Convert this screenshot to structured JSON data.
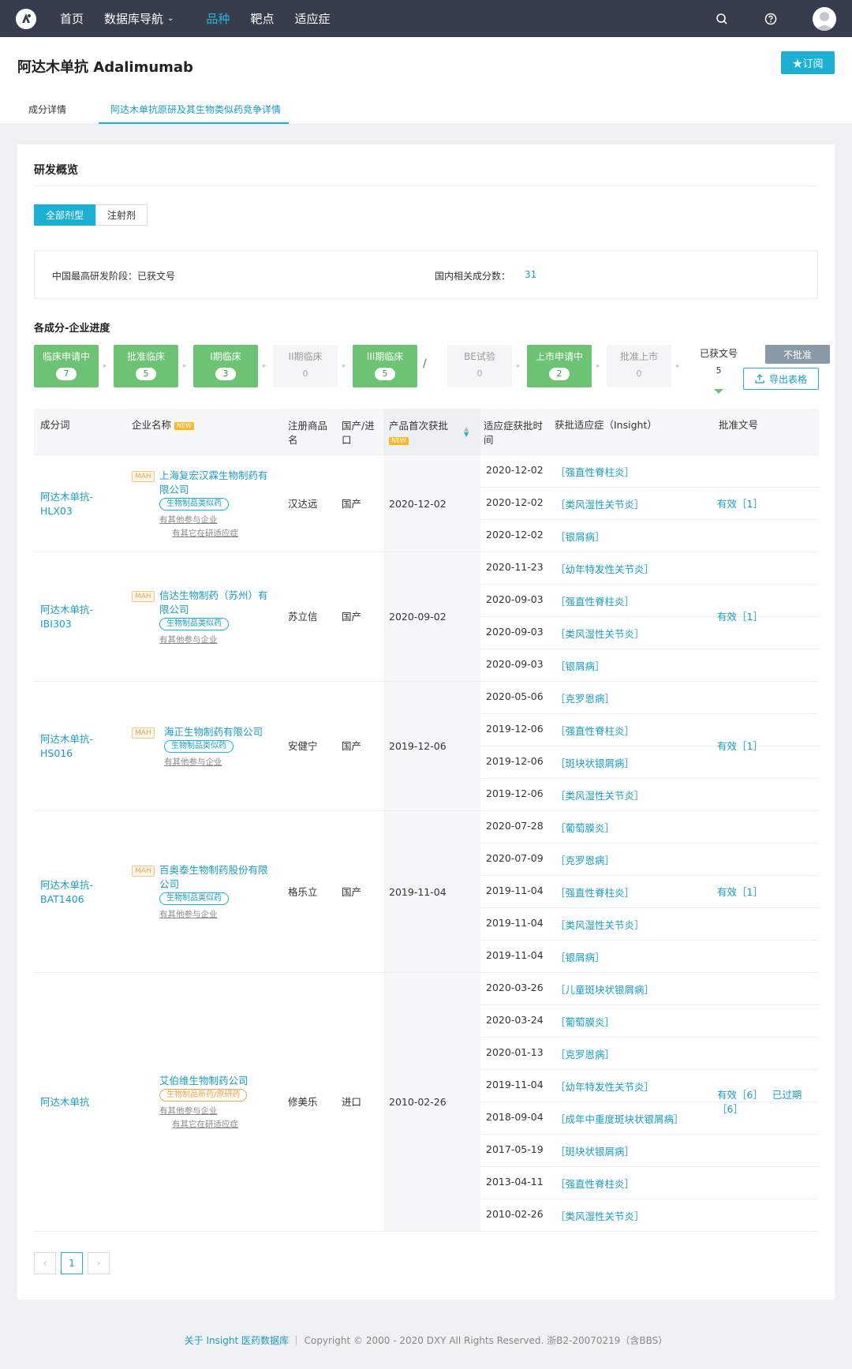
{
  "nav": {
    "items": [
      {
        "label": "首页",
        "active": false,
        "dropdown": false
      },
      {
        "label": "数据库导航",
        "active": false,
        "dropdown": true
      },
      {
        "label": "品种",
        "active": true,
        "dropdown": false
      },
      {
        "label": "靶点",
        "active": false,
        "dropdown": false
      },
      {
        "label": "适应症",
        "active": false,
        "dropdown": false
      }
    ],
    "icons": [
      "search-icon",
      "help-icon",
      "avatar"
    ]
  },
  "header": {
    "title": "阿达木单抗 Adalimumab",
    "subscribe_label": "★订阅"
  },
  "tabs": [
    {
      "label": "成分详情",
      "active": false
    },
    {
      "label": "阿达木单抗原研及其生物类似药竞争详情",
      "active": true
    }
  ],
  "overview": {
    "title": "研发概览",
    "dosage_tabs": [
      {
        "label": "全部剂型",
        "active": true
      },
      {
        "label": "注射剂",
        "active": false
      }
    ],
    "highest_stage_label": "中国最高研发阶段：已获文号",
    "related_count_label": "国内相关成分数：",
    "related_count_value": "31"
  },
  "progress": {
    "title": "各成分-企业进度",
    "stages": [
      {
        "label": "临床申请中",
        "count": "7",
        "state": "on"
      },
      {
        "label": "批准临床",
        "count": "5",
        "state": "on"
      },
      {
        "label": "I期临床",
        "count": "3",
        "state": "on"
      },
      {
        "label": "II期临床",
        "count": "0",
        "state": "off"
      },
      {
        "label": "III期临床",
        "count": "5",
        "state": "on"
      },
      {
        "label": "BE试验",
        "count": "0",
        "state": "off"
      },
      {
        "label": "上市申请中",
        "count": "2",
        "state": "on"
      },
      {
        "label": "批准上市",
        "count": "0",
        "state": "off"
      },
      {
        "label": "已获文号",
        "count": "5",
        "state": "sel"
      },
      {
        "label": "不批准",
        "count": "",
        "state": "gray"
      }
    ],
    "slash": "/",
    "export_label": "导出表格"
  },
  "table": {
    "headers": {
      "ingredient": "成分词",
      "company": "企业名称",
      "company_badge": "NEW",
      "brand_1": "注册商品",
      "brand_2": "名",
      "origin_1": "国产/进",
      "origin_2": "口",
      "first_approval": "产品首次获批",
      "first_approval_badge": "NEW",
      "ind_time_1": "适应症获批时",
      "ind_time_2": "间",
      "indication": "获批适应症（Insight）",
      "approval_no": "批准文号"
    },
    "rows": [
      {
        "ingredient_1": "阿达木单抗-",
        "ingredient_2": "HLX03",
        "mah": "MAH",
        "company_1": "上海复宏汉霖生物制药有",
        "company_2": "限公司",
        "tag": "生物制品类似药",
        "link_1": "有其他参与企业",
        "link_2": "有其它在研适应症",
        "brand": "汉达远",
        "origin": "国产",
        "first_approval": "2020-12-02",
        "approval": "有效［1］",
        "indications": [
          {
            "date": "2020-12-02",
            "name": "［强直性脊柱炎］"
          },
          {
            "date": "2020-12-02",
            "name": "［类风湿性关节炎］"
          },
          {
            "date": "2020-12-02",
            "name": "［银屑病］"
          }
        ]
      },
      {
        "ingredient_1": "阿达木单抗-",
        "ingredient_2": "IBI303",
        "mah": "MAH",
        "company_1": "信达生物制药（苏州）有",
        "company_2": "限公司",
        "tag": "生物制品类似药",
        "link_1": "有其他参与企业",
        "brand": "苏立信",
        "origin": "国产",
        "first_approval": "2020-09-02",
        "approval": "有效［1］",
        "indications": [
          {
            "date": "2020-11-23",
            "name": "［幼年特发性关节炎］"
          },
          {
            "date": "2020-09-03",
            "name": "［强直性脊柱炎］"
          },
          {
            "date": "2020-09-03",
            "name": "［类风湿性关节炎］"
          },
          {
            "date": "2020-09-03",
            "name": "［银屑病］"
          }
        ]
      },
      {
        "ingredient_1": "阿达木单抗-",
        "ingredient_2": "HS016",
        "mah": "MAH",
        "company_1": "海正生物制药有限公司",
        "tag": "生物制品类似药",
        "link_1": "有其他参与企业",
        "brand": "安健宁",
        "origin": "国产",
        "first_approval": "2019-12-06",
        "approval": "有效［1］",
        "indications": [
          {
            "date": "2020-05-06",
            "name": "［克罗恩病］"
          },
          {
            "date": "2019-12-06",
            "name": "［强直性脊柱炎］"
          },
          {
            "date": "2019-12-06",
            "name": "［斑块状银屑病］"
          },
          {
            "date": "2019-12-06",
            "name": "［类风湿性关节炎］"
          }
        ]
      },
      {
        "ingredient_1": "阿达木单抗-",
        "ingredient_2": "BAT1406",
        "mah": "MAH",
        "company_1": "百奥泰生物制药股份有限",
        "company_2": "公司",
        "tag": "生物制品类似药",
        "link_1": "有其他参与企业",
        "brand": "格乐立",
        "origin": "国产",
        "first_approval": "2019-11-04",
        "approval": "有效［1］",
        "indications": [
          {
            "date": "2020-07-28",
            "name": "［葡萄膜炎］"
          },
          {
            "date": "2020-07-09",
            "name": "［克罗恩病］"
          },
          {
            "date": "2019-11-04",
            "name": "［强直性脊柱炎］"
          },
          {
            "date": "2019-11-04",
            "name": "［类风湿性关节炎］"
          },
          {
            "date": "2019-11-04",
            "name": "［银屑病］"
          }
        ]
      },
      {
        "ingredient_1": "阿达木单抗",
        "company_1": "艾伯维生物制药公司",
        "tag": "生物制品新药/原研药",
        "link_1": "有其他参与企业",
        "link_2": "有其它在研适应症",
        "brand": "修美乐",
        "origin": "进口",
        "first_approval": "2010-02-26",
        "approval": "有效［6］",
        "approval_expired": "已过期",
        "approval_expired_count": "［6］",
        "indications": [
          {
            "date": "2020-03-26",
            "name": "［儿童斑块状银屑病］"
          },
          {
            "date": "2020-03-24",
            "name": "［葡萄膜炎］"
          },
          {
            "date": "2020-01-13",
            "name": "［克罗恩病］"
          },
          {
            "date": "2019-11-04",
            "name": "［幼年特发性关节炎］"
          },
          {
            "date": "2018-09-04",
            "name": "［成年中重度斑块状银屑病］"
          },
          {
            "date": "2017-05-19",
            "name": "［斑块状银屑病］"
          },
          {
            "date": "2013-04-11",
            "name": "［强直性脊柱炎］"
          },
          {
            "date": "2010-02-26",
            "name": "［类风湿性关节炎］"
          }
        ]
      }
    ]
  },
  "pagination": {
    "prev": "‹",
    "current": "1",
    "next": "›"
  },
  "footer": {
    "link": "关于 Insight 医药数据库",
    "text": " ｜ Copyright © 2000 - 2020 DXY All Rights Reserved. 浙B2-20070219（含BBS）"
  }
}
